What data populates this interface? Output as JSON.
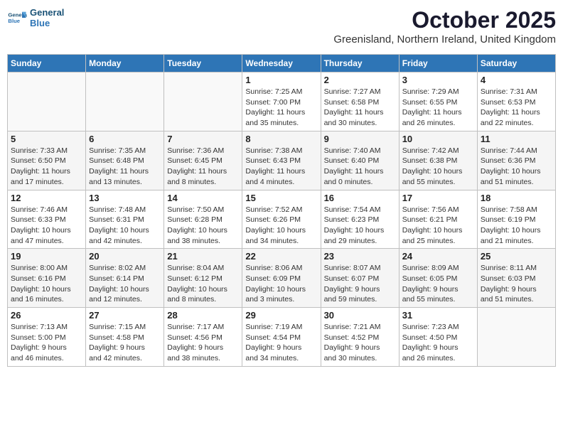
{
  "header": {
    "logo_line1": "General",
    "logo_line2": "Blue",
    "month": "October 2025",
    "location": "Greenisland, Northern Ireland, United Kingdom"
  },
  "weekdays": [
    "Sunday",
    "Monday",
    "Tuesday",
    "Wednesday",
    "Thursday",
    "Friday",
    "Saturday"
  ],
  "weeks": [
    [
      {
        "day": "",
        "info": ""
      },
      {
        "day": "",
        "info": ""
      },
      {
        "day": "",
        "info": ""
      },
      {
        "day": "1",
        "info": "Sunrise: 7:25 AM\nSunset: 7:00 PM\nDaylight: 11 hours\nand 35 minutes."
      },
      {
        "day": "2",
        "info": "Sunrise: 7:27 AM\nSunset: 6:58 PM\nDaylight: 11 hours\nand 30 minutes."
      },
      {
        "day": "3",
        "info": "Sunrise: 7:29 AM\nSunset: 6:55 PM\nDaylight: 11 hours\nand 26 minutes."
      },
      {
        "day": "4",
        "info": "Sunrise: 7:31 AM\nSunset: 6:53 PM\nDaylight: 11 hours\nand 22 minutes."
      }
    ],
    [
      {
        "day": "5",
        "info": "Sunrise: 7:33 AM\nSunset: 6:50 PM\nDaylight: 11 hours\nand 17 minutes."
      },
      {
        "day": "6",
        "info": "Sunrise: 7:35 AM\nSunset: 6:48 PM\nDaylight: 11 hours\nand 13 minutes."
      },
      {
        "day": "7",
        "info": "Sunrise: 7:36 AM\nSunset: 6:45 PM\nDaylight: 11 hours\nand 8 minutes."
      },
      {
        "day": "8",
        "info": "Sunrise: 7:38 AM\nSunset: 6:43 PM\nDaylight: 11 hours\nand 4 minutes."
      },
      {
        "day": "9",
        "info": "Sunrise: 7:40 AM\nSunset: 6:40 PM\nDaylight: 11 hours\nand 0 minutes."
      },
      {
        "day": "10",
        "info": "Sunrise: 7:42 AM\nSunset: 6:38 PM\nDaylight: 10 hours\nand 55 minutes."
      },
      {
        "day": "11",
        "info": "Sunrise: 7:44 AM\nSunset: 6:36 PM\nDaylight: 10 hours\nand 51 minutes."
      }
    ],
    [
      {
        "day": "12",
        "info": "Sunrise: 7:46 AM\nSunset: 6:33 PM\nDaylight: 10 hours\nand 47 minutes."
      },
      {
        "day": "13",
        "info": "Sunrise: 7:48 AM\nSunset: 6:31 PM\nDaylight: 10 hours\nand 42 minutes."
      },
      {
        "day": "14",
        "info": "Sunrise: 7:50 AM\nSunset: 6:28 PM\nDaylight: 10 hours\nand 38 minutes."
      },
      {
        "day": "15",
        "info": "Sunrise: 7:52 AM\nSunset: 6:26 PM\nDaylight: 10 hours\nand 34 minutes."
      },
      {
        "day": "16",
        "info": "Sunrise: 7:54 AM\nSunset: 6:23 PM\nDaylight: 10 hours\nand 29 minutes."
      },
      {
        "day": "17",
        "info": "Sunrise: 7:56 AM\nSunset: 6:21 PM\nDaylight: 10 hours\nand 25 minutes."
      },
      {
        "day": "18",
        "info": "Sunrise: 7:58 AM\nSunset: 6:19 PM\nDaylight: 10 hours\nand 21 minutes."
      }
    ],
    [
      {
        "day": "19",
        "info": "Sunrise: 8:00 AM\nSunset: 6:16 PM\nDaylight: 10 hours\nand 16 minutes."
      },
      {
        "day": "20",
        "info": "Sunrise: 8:02 AM\nSunset: 6:14 PM\nDaylight: 10 hours\nand 12 minutes."
      },
      {
        "day": "21",
        "info": "Sunrise: 8:04 AM\nSunset: 6:12 PM\nDaylight: 10 hours\nand 8 minutes."
      },
      {
        "day": "22",
        "info": "Sunrise: 8:06 AM\nSunset: 6:09 PM\nDaylight: 10 hours\nand 3 minutes."
      },
      {
        "day": "23",
        "info": "Sunrise: 8:07 AM\nSunset: 6:07 PM\nDaylight: 9 hours\nand 59 minutes."
      },
      {
        "day": "24",
        "info": "Sunrise: 8:09 AM\nSunset: 6:05 PM\nDaylight: 9 hours\nand 55 minutes."
      },
      {
        "day": "25",
        "info": "Sunrise: 8:11 AM\nSunset: 6:03 PM\nDaylight: 9 hours\nand 51 minutes."
      }
    ],
    [
      {
        "day": "26",
        "info": "Sunrise: 7:13 AM\nSunset: 5:00 PM\nDaylight: 9 hours\nand 46 minutes."
      },
      {
        "day": "27",
        "info": "Sunrise: 7:15 AM\nSunset: 4:58 PM\nDaylight: 9 hours\nand 42 minutes."
      },
      {
        "day": "28",
        "info": "Sunrise: 7:17 AM\nSunset: 4:56 PM\nDaylight: 9 hours\nand 38 minutes."
      },
      {
        "day": "29",
        "info": "Sunrise: 7:19 AM\nSunset: 4:54 PM\nDaylight: 9 hours\nand 34 minutes."
      },
      {
        "day": "30",
        "info": "Sunrise: 7:21 AM\nSunset: 4:52 PM\nDaylight: 9 hours\nand 30 minutes."
      },
      {
        "day": "31",
        "info": "Sunrise: 7:23 AM\nSunset: 4:50 PM\nDaylight: 9 hours\nand 26 minutes."
      },
      {
        "day": "",
        "info": ""
      }
    ]
  ]
}
